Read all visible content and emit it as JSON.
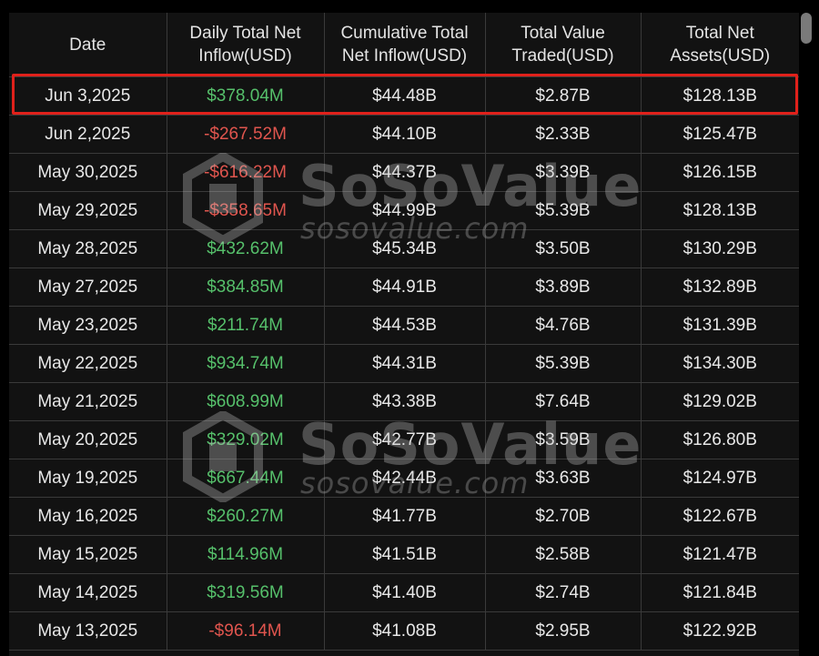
{
  "table": {
    "headers": [
      [
        "Date"
      ],
      [
        "Daily Total Net",
        "Inflow(USD)"
      ],
      [
        "Cumulative Total",
        "Net Inflow(USD)"
      ],
      [
        "Total Value",
        "Traded(USD)"
      ],
      [
        "Total Net",
        "Assets(USD)"
      ]
    ],
    "rows": [
      {
        "date": "Jun 3,2025",
        "daily": "$378.04M",
        "daily_sign": "pos",
        "cumulative": "$44.48B",
        "traded": "$2.87B",
        "assets": "$128.13B",
        "highlighted": true
      },
      {
        "date": "Jun 2,2025",
        "daily": "-$267.52M",
        "daily_sign": "neg",
        "cumulative": "$44.10B",
        "traded": "$2.33B",
        "assets": "$125.47B"
      },
      {
        "date": "May 30,2025",
        "daily": "-$616.22M",
        "daily_sign": "neg",
        "cumulative": "$44.37B",
        "traded": "$3.39B",
        "assets": "$126.15B"
      },
      {
        "date": "May 29,2025",
        "daily": "-$358.65M",
        "daily_sign": "neg",
        "cumulative": "$44.99B",
        "traded": "$5.39B",
        "assets": "$128.13B"
      },
      {
        "date": "May 28,2025",
        "daily": "$432.62M",
        "daily_sign": "pos",
        "cumulative": "$45.34B",
        "traded": "$3.50B",
        "assets": "$130.29B"
      },
      {
        "date": "May 27,2025",
        "daily": "$384.85M",
        "daily_sign": "pos",
        "cumulative": "$44.91B",
        "traded": "$3.89B",
        "assets": "$132.89B"
      },
      {
        "date": "May 23,2025",
        "daily": "$211.74M",
        "daily_sign": "pos",
        "cumulative": "$44.53B",
        "traded": "$4.76B",
        "assets": "$131.39B"
      },
      {
        "date": "May 22,2025",
        "daily": "$934.74M",
        "daily_sign": "pos",
        "cumulative": "$44.31B",
        "traded": "$5.39B",
        "assets": "$134.30B"
      },
      {
        "date": "May 21,2025",
        "daily": "$608.99M",
        "daily_sign": "pos",
        "cumulative": "$43.38B",
        "traded": "$7.64B",
        "assets": "$129.02B"
      },
      {
        "date": "May 20,2025",
        "daily": "$329.02M",
        "daily_sign": "pos",
        "cumulative": "$42.77B",
        "traded": "$3.59B",
        "assets": "$126.80B"
      },
      {
        "date": "May 19,2025",
        "daily": "$667.44M",
        "daily_sign": "pos",
        "cumulative": "$42.44B",
        "traded": "$3.63B",
        "assets": "$124.97B"
      },
      {
        "date": "May 16,2025",
        "daily": "$260.27M",
        "daily_sign": "pos",
        "cumulative": "$41.77B",
        "traded": "$2.70B",
        "assets": "$122.67B"
      },
      {
        "date": "May 15,2025",
        "daily": "$114.96M",
        "daily_sign": "pos",
        "cumulative": "$41.51B",
        "traded": "$2.58B",
        "assets": "$121.47B"
      },
      {
        "date": "May 14,2025",
        "daily": "$319.56M",
        "daily_sign": "pos",
        "cumulative": "$41.40B",
        "traded": "$2.74B",
        "assets": "$121.84B"
      },
      {
        "date": "May 13,2025",
        "daily": "-$96.14M",
        "daily_sign": "neg",
        "cumulative": "$41.08B",
        "traded": "$2.95B",
        "assets": "$122.92B"
      }
    ]
  },
  "watermark": {
    "name": "SoSoValue",
    "url": "sosovalue.com"
  },
  "colors": {
    "positive": "#56c06b",
    "negative": "#e0554e",
    "highlight_border": "#e0211b",
    "background": "#121212"
  }
}
